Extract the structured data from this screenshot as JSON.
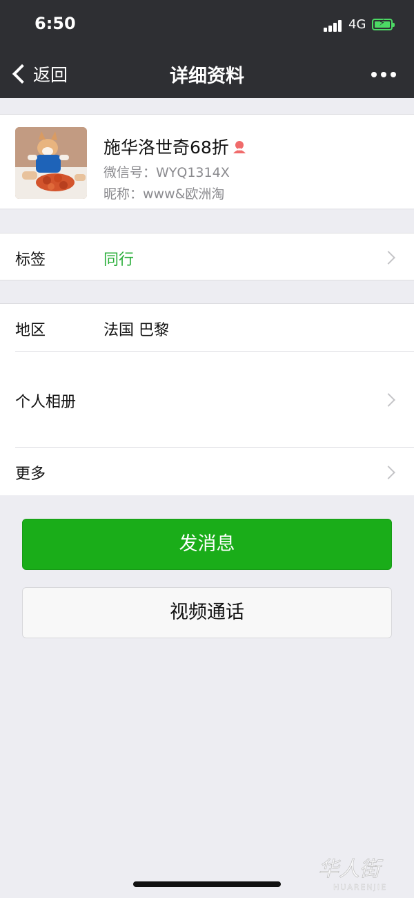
{
  "status_bar": {
    "time": "6:50",
    "network": "4G",
    "battery_icon": "battery-charging-icon"
  },
  "nav": {
    "back_label": "返回",
    "title": "详细资料",
    "more_icon": "more-dots-icon"
  },
  "profile": {
    "name": "施华洛世奇68折",
    "gender_icon": "female-icon",
    "wechat_id": "微信号：WYQ1314X",
    "nickname": "昵称：www&欧洲淘"
  },
  "tag_row": {
    "key": "标签",
    "value": "同行"
  },
  "info_rows": [
    {
      "key": "地区",
      "value": "法国 巴黎"
    },
    {
      "key": "个人相册"
    },
    {
      "key": "更多"
    }
  ],
  "buttons": {
    "send_message": "发消息",
    "video_call": "视频通话"
  },
  "watermark": {
    "text_cn": "华人街",
    "text_en": "HUARENJIE"
  },
  "colors": {
    "nav_bg": "#2e2f33",
    "accent_green": "#1aad19",
    "tag_green": "#2aae3a",
    "page_bg": "#ededf2"
  }
}
